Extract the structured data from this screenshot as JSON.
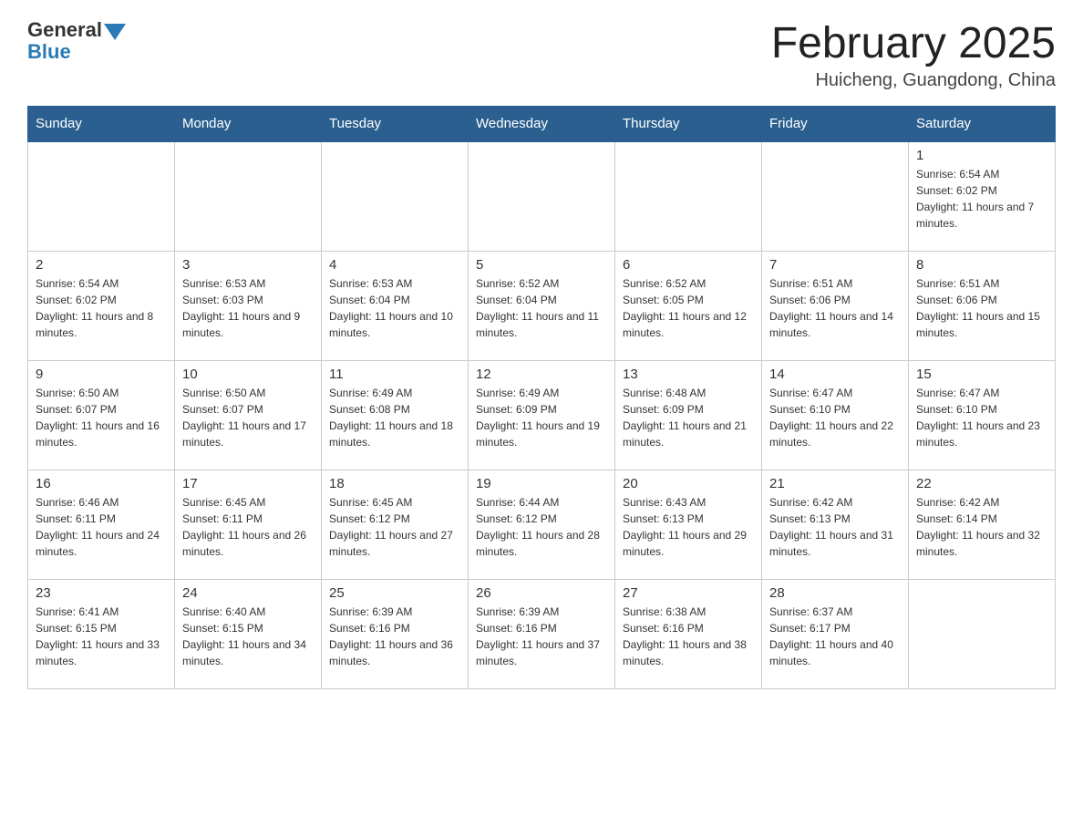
{
  "header": {
    "logo_text": "General",
    "logo_blue": "Blue",
    "title": "February 2025",
    "location": "Huicheng, Guangdong, China"
  },
  "weekdays": [
    "Sunday",
    "Monday",
    "Tuesday",
    "Wednesday",
    "Thursday",
    "Friday",
    "Saturday"
  ],
  "weeks": [
    [
      {
        "day": "",
        "info": ""
      },
      {
        "day": "",
        "info": ""
      },
      {
        "day": "",
        "info": ""
      },
      {
        "day": "",
        "info": ""
      },
      {
        "day": "",
        "info": ""
      },
      {
        "day": "",
        "info": ""
      },
      {
        "day": "1",
        "info": "Sunrise: 6:54 AM\nSunset: 6:02 PM\nDaylight: 11 hours and 7 minutes."
      }
    ],
    [
      {
        "day": "2",
        "info": "Sunrise: 6:54 AM\nSunset: 6:02 PM\nDaylight: 11 hours and 8 minutes."
      },
      {
        "day": "3",
        "info": "Sunrise: 6:53 AM\nSunset: 6:03 PM\nDaylight: 11 hours and 9 minutes."
      },
      {
        "day": "4",
        "info": "Sunrise: 6:53 AM\nSunset: 6:04 PM\nDaylight: 11 hours and 10 minutes."
      },
      {
        "day": "5",
        "info": "Sunrise: 6:52 AM\nSunset: 6:04 PM\nDaylight: 11 hours and 11 minutes."
      },
      {
        "day": "6",
        "info": "Sunrise: 6:52 AM\nSunset: 6:05 PM\nDaylight: 11 hours and 12 minutes."
      },
      {
        "day": "7",
        "info": "Sunrise: 6:51 AM\nSunset: 6:06 PM\nDaylight: 11 hours and 14 minutes."
      },
      {
        "day": "8",
        "info": "Sunrise: 6:51 AM\nSunset: 6:06 PM\nDaylight: 11 hours and 15 minutes."
      }
    ],
    [
      {
        "day": "9",
        "info": "Sunrise: 6:50 AM\nSunset: 6:07 PM\nDaylight: 11 hours and 16 minutes."
      },
      {
        "day": "10",
        "info": "Sunrise: 6:50 AM\nSunset: 6:07 PM\nDaylight: 11 hours and 17 minutes."
      },
      {
        "day": "11",
        "info": "Sunrise: 6:49 AM\nSunset: 6:08 PM\nDaylight: 11 hours and 18 minutes."
      },
      {
        "day": "12",
        "info": "Sunrise: 6:49 AM\nSunset: 6:09 PM\nDaylight: 11 hours and 19 minutes."
      },
      {
        "day": "13",
        "info": "Sunrise: 6:48 AM\nSunset: 6:09 PM\nDaylight: 11 hours and 21 minutes."
      },
      {
        "day": "14",
        "info": "Sunrise: 6:47 AM\nSunset: 6:10 PM\nDaylight: 11 hours and 22 minutes."
      },
      {
        "day": "15",
        "info": "Sunrise: 6:47 AM\nSunset: 6:10 PM\nDaylight: 11 hours and 23 minutes."
      }
    ],
    [
      {
        "day": "16",
        "info": "Sunrise: 6:46 AM\nSunset: 6:11 PM\nDaylight: 11 hours and 24 minutes."
      },
      {
        "day": "17",
        "info": "Sunrise: 6:45 AM\nSunset: 6:11 PM\nDaylight: 11 hours and 26 minutes."
      },
      {
        "day": "18",
        "info": "Sunrise: 6:45 AM\nSunset: 6:12 PM\nDaylight: 11 hours and 27 minutes."
      },
      {
        "day": "19",
        "info": "Sunrise: 6:44 AM\nSunset: 6:12 PM\nDaylight: 11 hours and 28 minutes."
      },
      {
        "day": "20",
        "info": "Sunrise: 6:43 AM\nSunset: 6:13 PM\nDaylight: 11 hours and 29 minutes."
      },
      {
        "day": "21",
        "info": "Sunrise: 6:42 AM\nSunset: 6:13 PM\nDaylight: 11 hours and 31 minutes."
      },
      {
        "day": "22",
        "info": "Sunrise: 6:42 AM\nSunset: 6:14 PM\nDaylight: 11 hours and 32 minutes."
      }
    ],
    [
      {
        "day": "23",
        "info": "Sunrise: 6:41 AM\nSunset: 6:15 PM\nDaylight: 11 hours and 33 minutes."
      },
      {
        "day": "24",
        "info": "Sunrise: 6:40 AM\nSunset: 6:15 PM\nDaylight: 11 hours and 34 minutes."
      },
      {
        "day": "25",
        "info": "Sunrise: 6:39 AM\nSunset: 6:16 PM\nDaylight: 11 hours and 36 minutes."
      },
      {
        "day": "26",
        "info": "Sunrise: 6:39 AM\nSunset: 6:16 PM\nDaylight: 11 hours and 37 minutes."
      },
      {
        "day": "27",
        "info": "Sunrise: 6:38 AM\nSunset: 6:16 PM\nDaylight: 11 hours and 38 minutes."
      },
      {
        "day": "28",
        "info": "Sunrise: 6:37 AM\nSunset: 6:17 PM\nDaylight: 11 hours and 40 minutes."
      },
      {
        "day": "",
        "info": ""
      }
    ]
  ]
}
